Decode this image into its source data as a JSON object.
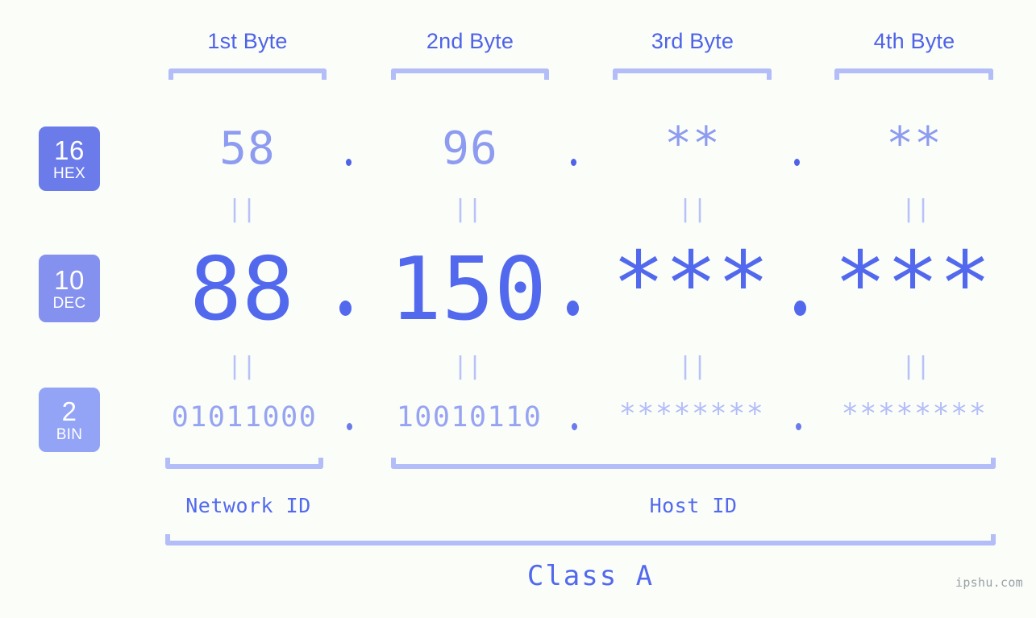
{
  "theme": {
    "background": "#fbfdf9",
    "primary": "#4f63e8",
    "dec_color": "#5269ee",
    "hex_color": "#8d9bf0",
    "bin_color": "#96a4f2",
    "bracket_color": "#b3bdf8",
    "badge_hex": "#6b7cea",
    "badge_dec": "#8491ef",
    "badge_bin": "#93a3f5",
    "watermark_color": "#9aa0a6"
  },
  "headers": {
    "byte_titles": [
      "1st Byte",
      "2nd Byte",
      "3rd Byte",
      "4th Byte"
    ]
  },
  "badges": [
    {
      "num": "16",
      "label": "HEX"
    },
    {
      "num": "10",
      "label": "DEC"
    },
    {
      "num": "2",
      "label": "BIN"
    }
  ],
  "rows": {
    "hex": {
      "radix": "16",
      "radix_label": "HEX",
      "values": [
        "58",
        "96",
        "**",
        "**"
      ],
      "separator": "."
    },
    "dec": {
      "radix": "10",
      "radix_label": "DEC",
      "values": [
        "88",
        "150",
        "***",
        "***"
      ],
      "separator": "."
    },
    "bin": {
      "radix": "2",
      "radix_label": "BIN",
      "values": [
        "01011000",
        "10010110",
        "********",
        "********"
      ],
      "separator": "."
    }
  },
  "equals": {
    "glyph": "||",
    "hex_to_dec": [
      "||",
      "||",
      "||",
      "||"
    ],
    "dec_to_bin": [
      "||",
      "||",
      "||",
      "||"
    ]
  },
  "footer": {
    "network_id_label": "Network ID",
    "host_id_label": "Host ID",
    "class_label": "Class A",
    "watermark": "ipshu.com"
  }
}
